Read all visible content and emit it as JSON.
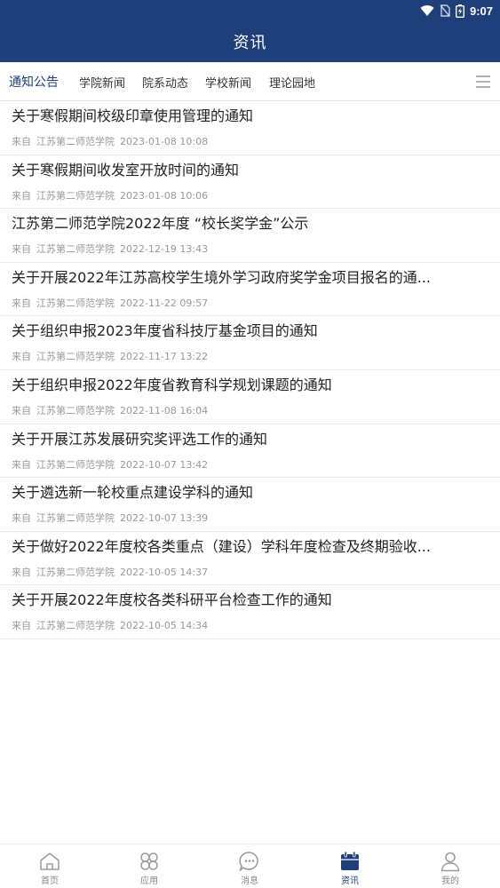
{
  "status_bar": {
    "time": "9:07",
    "icons": [
      "wifi-icon",
      "no-sim-icon",
      "battery-charging-icon"
    ]
  },
  "header": {
    "title": "资讯"
  },
  "tabs": [
    {
      "label": "通知公告",
      "active": true
    },
    {
      "label": "学院新闻",
      "active": false
    },
    {
      "label": "院系动态",
      "active": false
    },
    {
      "label": "学校新闻",
      "active": false
    },
    {
      "label": "理论园地",
      "active": false
    }
  ],
  "tab_menu_icon": "menu-icon",
  "news": [
    {
      "title": "关于寒假期间校级印章使用管理的通知",
      "from": "来自",
      "source": "江苏第二师范学院",
      "date": "2023-01-08 10:08"
    },
    {
      "title": "关于寒假期间收发室开放时间的通知",
      "from": "来自",
      "source": "江苏第二师范学院",
      "date": "2023-01-08 10:06"
    },
    {
      "title": "江苏第二师范学院2022年度 “校长奖学金”公示",
      "from": "来自",
      "source": "江苏第二师范学院",
      "date": "2022-12-19 13:43"
    },
    {
      "title": "关于开展2022年江苏高校学生境外学习政府奖学金项目报名的通...",
      "from": "来自",
      "source": "江苏第二师范学院",
      "date": "2022-11-22 09:57"
    },
    {
      "title": "关于组织申报2023年度省科技厅基金项目的通知",
      "from": "来自",
      "source": "江苏第二师范学院",
      "date": "2022-11-17 13:22"
    },
    {
      "title": "关于组织申报2022年度省教育科学规划课题的通知",
      "from": "来自",
      "source": "江苏第二师范学院",
      "date": "2022-11-08 16:04"
    },
    {
      "title": "关于开展江苏发展研究奖评选工作的通知",
      "from": "来自",
      "source": "江苏第二师范学院",
      "date": "2022-10-07 13:42"
    },
    {
      "title": "关于遴选新一轮校重点建设学科的通知",
      "from": "来自",
      "source": "江苏第二师范学院",
      "date": "2022-10-07 13:39"
    },
    {
      "title": "关于做好2022年度校各类重点（建设）学科年度检查及终期验收...",
      "from": "来自",
      "source": "江苏第二师范学院",
      "date": "2022-10-05 14:37"
    },
    {
      "title": "关于开展2022年度校各类科研平台检查工作的通知",
      "from": "来自",
      "source": "江苏第二师范学院",
      "date": "2022-10-05 14:34"
    }
  ],
  "bottom_nav": [
    {
      "label": "首页",
      "icon": "home-icon",
      "active": false
    },
    {
      "label": "应用",
      "icon": "apps-icon",
      "active": false
    },
    {
      "label": "消息",
      "icon": "message-icon",
      "active": false
    },
    {
      "label": "资讯",
      "icon": "news-icon",
      "active": true
    },
    {
      "label": "我的",
      "icon": "profile-icon",
      "active": false
    }
  ],
  "colors": {
    "primary": "#1e3f7a",
    "text": "#222222",
    "meta": "#999999",
    "inactive_nav": "#888888"
  }
}
